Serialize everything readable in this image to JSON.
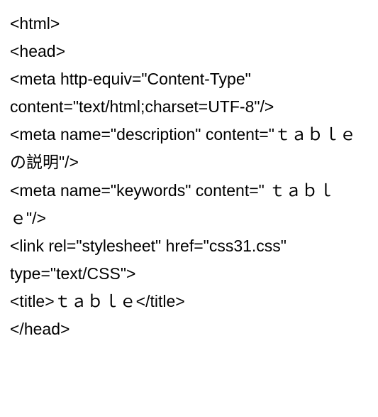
{
  "lines": [
    "<html>",
    "<head>",
    "<meta http-equiv=\"Content-Type\" content=\"text/html;charset=UTF-8\"/>",
    "<meta name=\"description\" content=\"ｔａｂｌｅ の説明\"/>",
    "<meta name=\"keywords\" content=\" ｔａｂｌｅ\"/>",
    "<link rel=\"stylesheet\" href=\"css31.css\" type=\"text/CSS\">",
    "<title>ｔａｂｌｅ</title>",
    "</head>"
  ]
}
